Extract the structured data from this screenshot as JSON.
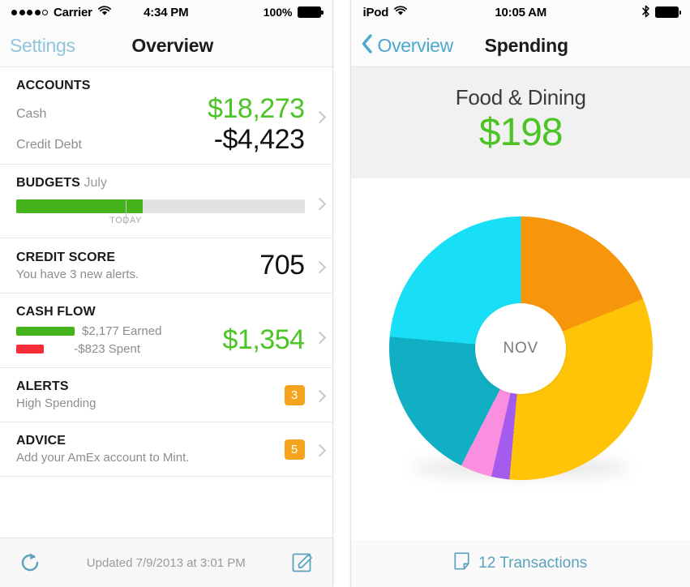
{
  "colors": {
    "green": "#4CC425",
    "bar_green": "#45b31c",
    "bar_red": "#f72c38",
    "badge_orange": "#f5a31e",
    "link_blue_faded": "#8fc6dc",
    "link_blue": "#4ba8ce",
    "chevron_grey": "#c8c8c8"
  },
  "left_phone": {
    "status_bar": {
      "signal_dots_filled": 4,
      "signal_dots_hollow": 1,
      "carrier": "Carrier",
      "wifi_icon": "wifi-icon",
      "time": "4:34 PM",
      "battery_percent": "100%",
      "battery_icon": "battery-full-icon"
    },
    "nav": {
      "back_label": "Settings",
      "title": "Overview"
    },
    "rows": [
      {
        "id": "accounts",
        "title": "ACCOUNTS",
        "lines": [
          {
            "label": "Cash",
            "value": "$18,273",
            "tone": "green"
          },
          {
            "label": "Credit Debt",
            "value": "-$4,423",
            "tone": "black"
          }
        ]
      },
      {
        "id": "budgets",
        "title": "BUDGETS",
        "month": "July",
        "progress_percent": 44,
        "today_percent": 38,
        "today_label": "TODAY"
      },
      {
        "id": "credit-score",
        "title": "CREDIT SCORE",
        "subtitle": "You have 3 new alerts.",
        "value": "705"
      },
      {
        "id": "cash-flow",
        "title": "CASH FLOW",
        "earned": "$2,177 Earned",
        "spent": "-$823 Spent",
        "total": "$1,354"
      },
      {
        "id": "alerts",
        "title": "ALERTS",
        "subtitle": "High Spending",
        "badge": "3"
      },
      {
        "id": "advice",
        "title": "ADVICE",
        "subtitle": "Add your AmEx account to Mint.",
        "badge": "5"
      }
    ],
    "toolbar": {
      "refresh_icon": "refresh-icon",
      "updated_text": "Updated 7/9/2013 at 3:01 PM",
      "compose_icon": "compose-icon"
    }
  },
  "right_phone": {
    "status_bar": {
      "device": "iPod",
      "wifi_icon": "wifi-icon",
      "time": "10:05 AM",
      "bluetooth_icon": "bluetooth-icon",
      "battery_icon": "battery-full-icon"
    },
    "nav": {
      "back_icon": "chevron-left-icon",
      "back_label": "Overview",
      "title": "Spending"
    },
    "summary": {
      "category": "Food & Dining",
      "amount": "$198"
    },
    "donut_center_label": "NOV",
    "transactions": {
      "icon": "note-icon",
      "label": "12 Transactions"
    }
  },
  "chart_data": {
    "type": "pie",
    "title": "Spending by category",
    "center_label": "NOV",
    "donut": true,
    "inner_radius_ratio": 0.345,
    "start_angle_deg": 0,
    "direction": "clockwise",
    "units": "degrees of a 360° circle",
    "categories": [
      "Orange",
      "Amber",
      "Purple",
      "Pink",
      "Teal",
      "Cyan"
    ],
    "values": [
      68,
      117,
      8,
      14,
      68,
      85
    ],
    "colors": [
      "#F8960B",
      "#FFC408",
      "#A45CEF",
      "#FA8FDF",
      "#11AFC4",
      "#18DFF5"
    ],
    "legend": "none",
    "grid": false
  }
}
